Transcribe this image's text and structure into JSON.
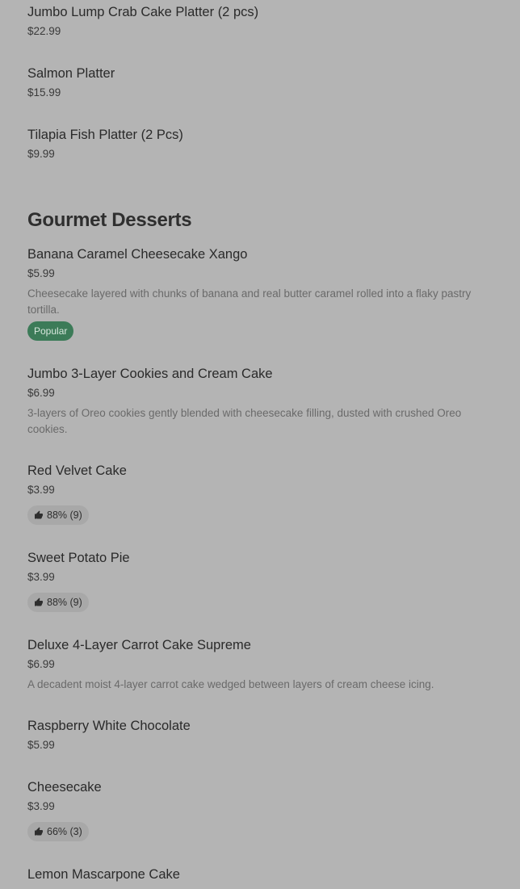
{
  "previous_items": [
    {
      "name": "Jumbo Lump Crab Cake Platter (2 pcs)",
      "price": "$22.99"
    },
    {
      "name": "Salmon Platter",
      "price": "$15.99"
    },
    {
      "name": "Tilapia Fish Platter (2 Pcs)",
      "price": "$9.99"
    }
  ],
  "section": {
    "title": "Gourmet Desserts",
    "items": [
      {
        "name": "Banana Caramel Cheesecake Xango",
        "price": "$5.99",
        "description": "Cheesecake layered with chunks of banana and real butter caramel rolled into a flaky pastry tortilla.",
        "badge": "Popular"
      },
      {
        "name": "Jumbo 3-Layer Cookies and Cream Cake",
        "price": "$6.99",
        "description": "3-layers of Oreo cookies gently blended with cheesecake filling, dusted with crushed Oreo cookies."
      },
      {
        "name": "Red Velvet Cake",
        "price": "$3.99",
        "rating": "88% (9)",
        "rating_icon": "thumbs-up-icon"
      },
      {
        "name": "Sweet Potato Pie",
        "price": "$3.99",
        "rating": "88% (9)",
        "rating_icon": "thumbs-up-icon"
      },
      {
        "name": "Deluxe 4-Layer Carrot Cake Supreme",
        "price": "$6.99",
        "description": "A decadent moist 4-layer carrot cake wedged between layers of cream cheese icing."
      },
      {
        "name": "Raspberry White Chocolate",
        "price": "$5.99"
      },
      {
        "name": "Cheesecake",
        "price": "$3.99",
        "rating": "66% (3)",
        "rating_icon": "thumbs-up-icon"
      },
      {
        "name": "Lemon Mascarpone Cake"
      }
    ]
  },
  "colors": {
    "background": "#b4b4b4",
    "popular_badge": "#3c7b58",
    "rating_pill": "#a8a8a8"
  }
}
